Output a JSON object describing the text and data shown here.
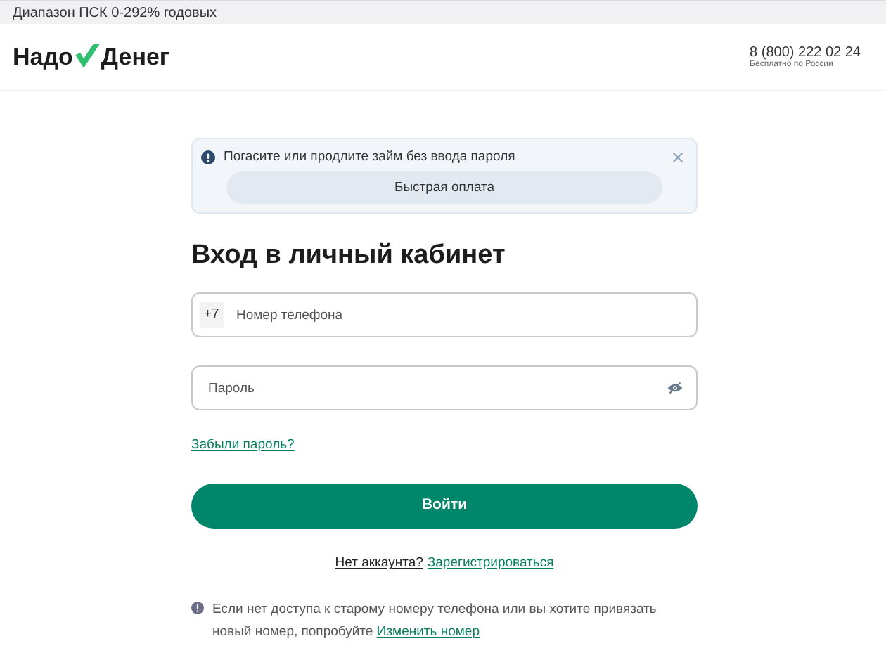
{
  "top_bar": {
    "text": "Диапазон ПСК 0-292% годовых"
  },
  "header": {
    "logo": {
      "left": "Надо",
      "right": "Денег"
    },
    "phone": "8 (800) 222 02 24",
    "phone_note": "Бесплатно по России"
  },
  "notice": {
    "text": "Погасите или продлите займ без ввода пароля",
    "button": "Быстрая оплата"
  },
  "title": "Вход в личный кабинет",
  "phone_field": {
    "prefix": "+7",
    "placeholder": "Номер телефона"
  },
  "password_field": {
    "placeholder": "Пароль"
  },
  "forgot_link": "Забыли пароль?",
  "login_button": "Войти",
  "register": {
    "text": "Нет аккаунта?",
    "link": "Зарегистрироваться"
  },
  "note": {
    "text": "Если нет доступа к старому номеру телефона или вы хотите привязать новый номер, попробуйте",
    "link": "Изменить номер"
  }
}
